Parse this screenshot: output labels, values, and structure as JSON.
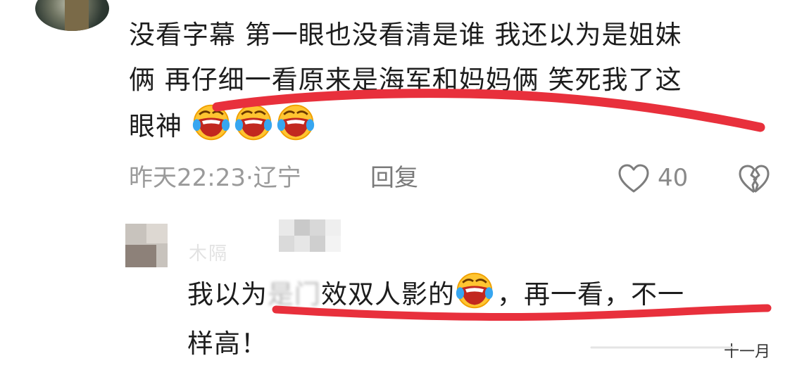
{
  "comment": {
    "text_line1": "没看字幕 第一眼也没看清是谁 我还以为是姐妹",
    "text_line2": "俩 再仔细一看原来是海军和妈妈俩 笑死我了这",
    "text_line3": "眼神",
    "emoji_icon": "laughing-crying-emoji",
    "emoji_count": 3,
    "time": "昨天22:23",
    "separator": " · ",
    "location": "辽宁",
    "reply_label": "回复",
    "like_count": "40"
  },
  "reply": {
    "name_fragment": "木隔",
    "text_prefix": "我以为",
    "text_blurred": "是门",
    "text_suffix": "效双人影的",
    "text_after_emoji": "，再一看，不一",
    "text_line2": "样高！",
    "time": "十一月"
  },
  "colors": {
    "underline": "#e8303c",
    "meta_gray": "#9a9a9a",
    "text": "#1d1d1d"
  }
}
